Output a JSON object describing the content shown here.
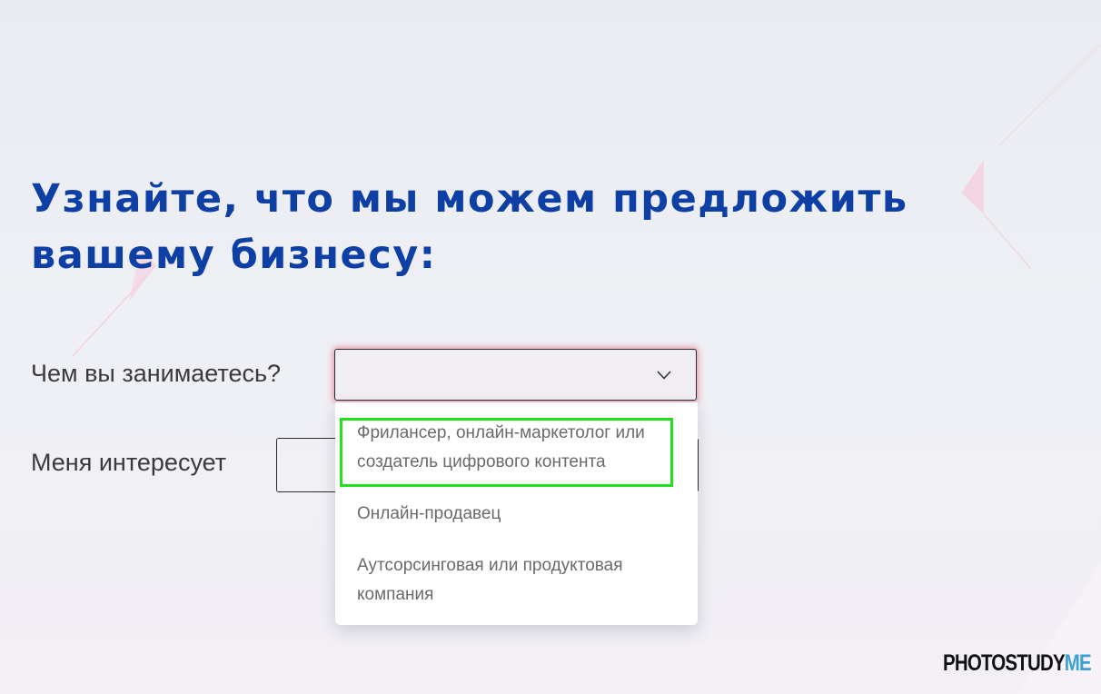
{
  "headline": "Узнайте, что мы можем предложить вашему бизнесу:",
  "form": {
    "question_1_label": "Чем вы занимаетесь?",
    "question_1_value": "",
    "question_2_label": "Меня интересует",
    "question_2_value": ""
  },
  "dropdown": {
    "options": [
      "Фрилансер, онлайн-маркетолог или создатель цифрового контента",
      "Онлайн-продавец",
      "Аутсорсинговая или продуктовая компания"
    ],
    "highlighted_option_index": 0
  },
  "watermark": {
    "part_1": "PHOTOSTUDY",
    "part_2": "ME"
  },
  "colors": {
    "headline": "#0e3fa5",
    "highlight_border": "#22e01c",
    "focus_glow": "#e8586c",
    "watermark_accent": "#3aa0d8"
  },
  "icons": {
    "dropdown_chevron": "chevron-down-icon"
  }
}
